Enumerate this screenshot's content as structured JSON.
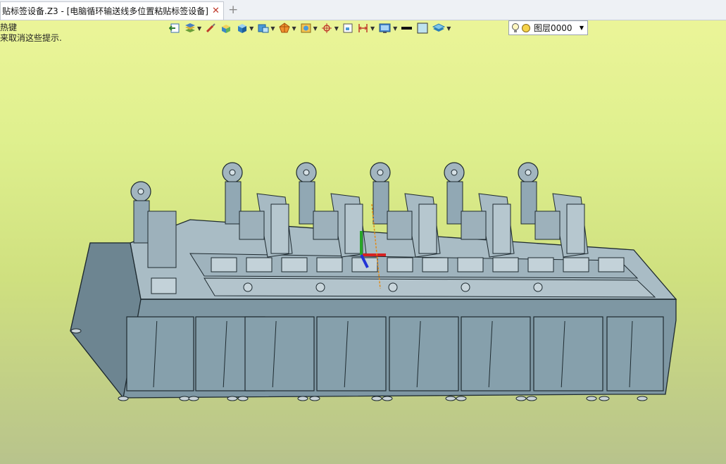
{
  "tab": {
    "title": "贴标签设备.Z3 - [电脑循环输送线多位置粘贴标签设备]",
    "close": "✕",
    "new_tab": "+"
  },
  "hint": {
    "line1": "热键",
    "line2": "来取消这些提示."
  },
  "toolbar": {
    "items": [
      "exit-icon",
      "layers-icon",
      "brush-icon",
      "solid-icon",
      "cube-icon",
      "box-view-icon",
      "shade-icon",
      "render-icon",
      "snap-icon",
      "grid-icon",
      "dimension-icon",
      "display-icon",
      "line-color-icon",
      "fill-color-icon",
      "stack-icon"
    ],
    "layer_value": "图层0000"
  },
  "colors": {
    "bg_top": "#edf59a",
    "bg_bottom": "#b8c38c",
    "model": "#8fa7b3",
    "edge": "#1e2a30"
  }
}
